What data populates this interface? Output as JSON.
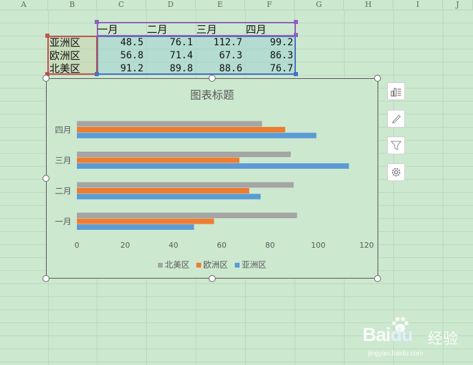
{
  "columns": [
    "A",
    "B",
    "C",
    "D",
    "E",
    "F",
    "G",
    "H",
    "I",
    "J"
  ],
  "table": {
    "header": [
      "一月",
      "二月",
      "三月",
      "四月"
    ],
    "rows": [
      {
        "label": "亚洲区",
        "values": [
          "48.5",
          "76.1",
          "112.7",
          "99.2"
        ]
      },
      {
        "label": "欧洲区",
        "values": [
          "56.8",
          "71.4",
          "67.3",
          "86.3"
        ]
      },
      {
        "label": "北美区",
        "values": [
          "91.2",
          "89.8",
          "88.6",
          "76.7"
        ]
      }
    ]
  },
  "colors": {
    "sheet_bg": "#cce8cf",
    "series_na": "#a5a5a5",
    "series_eu": "#ed7d31",
    "series_as": "#5b9bd5",
    "sel_purple": "#8e5fbf",
    "sel_red": "#c0504d",
    "sel_blue": "#4472c4"
  },
  "chart_data": {
    "type": "bar",
    "orientation": "horizontal",
    "title": "图表标题",
    "categories": [
      "一月",
      "二月",
      "三月",
      "四月"
    ],
    "series": [
      {
        "name": "北美区",
        "color": "#a5a5a5",
        "values": [
          91.2,
          89.8,
          88.6,
          76.7
        ]
      },
      {
        "name": "欧洲区",
        "color": "#ed7d31",
        "values": [
          56.8,
          71.4,
          67.3,
          86.3
        ]
      },
      {
        "name": "亚洲区",
        "color": "#5b9bd5",
        "values": [
          48.5,
          76.1,
          112.7,
          99.2
        ]
      }
    ],
    "xlim": [
      0,
      120
    ],
    "xticks": [
      "0",
      "20",
      "40",
      "60",
      "80",
      "100",
      "120"
    ],
    "legend": "bottom",
    "grid": false
  },
  "side_tools": [
    "chart-elements-icon",
    "chart-style-icon",
    "chart-filter-icon",
    "chart-settings-icon"
  ],
  "watermark": {
    "brand": "Bai",
    "brand2": "du",
    "jingyan": "经验",
    "url": "jingyan.baidu.com"
  }
}
